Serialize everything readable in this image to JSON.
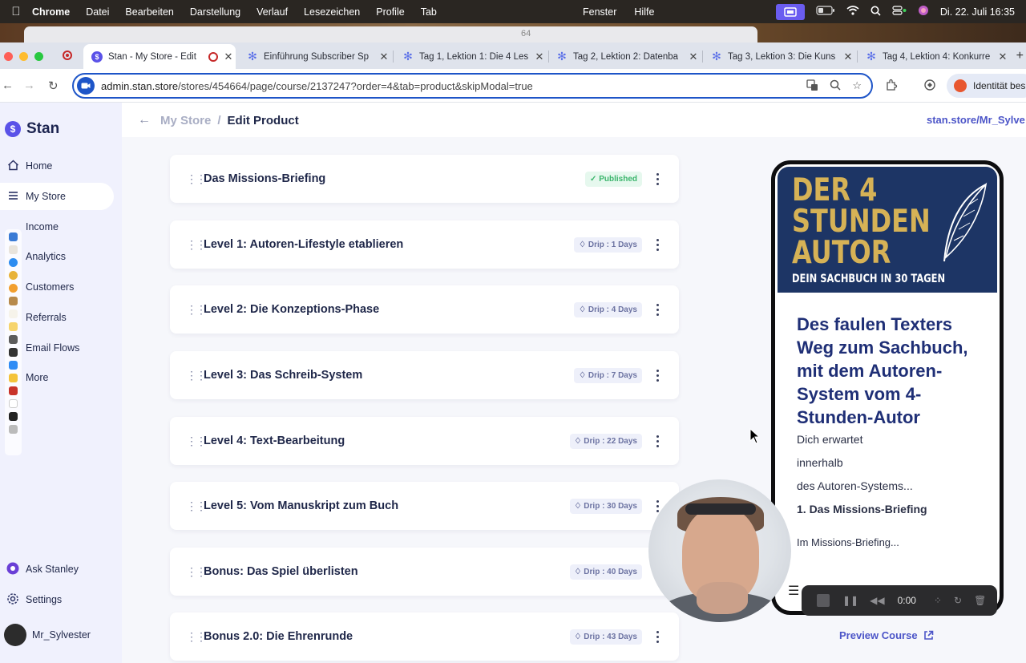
{
  "menubar": {
    "app": "Chrome",
    "items": [
      "Datei",
      "Bearbeiten",
      "Darstellung",
      "Verlauf",
      "Lesezeichen",
      "Profile",
      "Tab"
    ],
    "center_items": [
      "Fenster",
      "Hilfe"
    ],
    "datetime": "Di. 22. Juli 16:35"
  },
  "desktop": {
    "behind_text": "64"
  },
  "tabs": [
    {
      "title": "Stan - My Store - Edit",
      "active": true
    },
    {
      "title": "Einführung Subscriber Sp"
    },
    {
      "title": "Tag 1, Lektion 1: Die 4 Les"
    },
    {
      "title": "Tag 2, Lektion 2: Datenba"
    },
    {
      "title": "Tag 3, Lektion 3: Die Kuns"
    },
    {
      "title": "Tag 4, Lektion 4: Konkurre"
    }
  ],
  "address": {
    "host": "admin.stan.store",
    "path": "/stores/454664/page/course/2137247?order=4&tab=product&skipModal=true",
    "profile_label": "Identität bes"
  },
  "sidebar": {
    "brand": "Stan",
    "items": [
      {
        "label": "Home",
        "icon": "home-icon"
      },
      {
        "label": "My Store",
        "icon": "store-icon"
      },
      {
        "label": "Income",
        "icon": "income-icon"
      },
      {
        "label": "Analytics",
        "icon": "analytics-icon"
      },
      {
        "label": "Customers",
        "icon": "customers-icon"
      },
      {
        "label": "Referrals",
        "icon": "referrals-icon"
      },
      {
        "label": "Email Flows",
        "icon": "email-icon"
      },
      {
        "label": "More",
        "icon": "more-icon"
      }
    ],
    "ask": "Ask Stanley",
    "settings": "Settings",
    "user": "Mr_Sylvester"
  },
  "header": {
    "crumb_parent": "My Store",
    "crumb_sep": "/",
    "crumb_current": "Edit Product",
    "store_link": "stan.store/Mr_Sylve"
  },
  "modules": [
    {
      "title": "Das Missions-Briefing",
      "badge": "Published",
      "type": "pub"
    },
    {
      "title": "Level 1: Autoren-Lifestyle etablieren",
      "badge": "Drip : 1 Days",
      "type": "drip"
    },
    {
      "title": "Level 2: Die Konzeptions-Phase",
      "badge": "Drip : 4 Days",
      "type": "drip"
    },
    {
      "title": "Level 3: Das Schreib-System",
      "badge": "Drip : 7 Days",
      "type": "drip"
    },
    {
      "title": "Level 4: Text-Bearbeitung",
      "badge": "Drip : 22 Days",
      "type": "drip"
    },
    {
      "title": "Level 5: Vom Manuskript zum Buch",
      "badge": "Drip : 30 Days",
      "type": "drip"
    },
    {
      "title": "Bonus: Das Spiel überlisten",
      "badge": "Drip : 40 Days",
      "type": "drip"
    },
    {
      "title": "Bonus 2.0: Die Ehrenrunde",
      "badge": "Drip : 43 Days",
      "type": "drip"
    }
  ],
  "preview": {
    "cover_title_1": "DER 4",
    "cover_title_2": "STUNDEN",
    "cover_title_3": "AUTOR",
    "cover_subtitle": "DEIN SACHBUCH IN 30 TAGEN",
    "headline": "Des faulen Texters Weg zum Sachbuch, mit dem Autoren-System vom 4-Stunden-Autor",
    "line1": "Dich erwartet",
    "line2": "innerhalb",
    "line3": "des Autoren-Systems...",
    "line4": "1. Das Missions-Briefing",
    "line5": "Im Missions-Briefing...",
    "link": "Preview Course"
  },
  "recorder": {
    "time": "0:00"
  },
  "colors": {
    "accent": "#4c55c8",
    "brand": "#5a52e8",
    "published": "#3bb56c",
    "cover": "#1d3565",
    "cover_gold": "#d6b256"
  }
}
